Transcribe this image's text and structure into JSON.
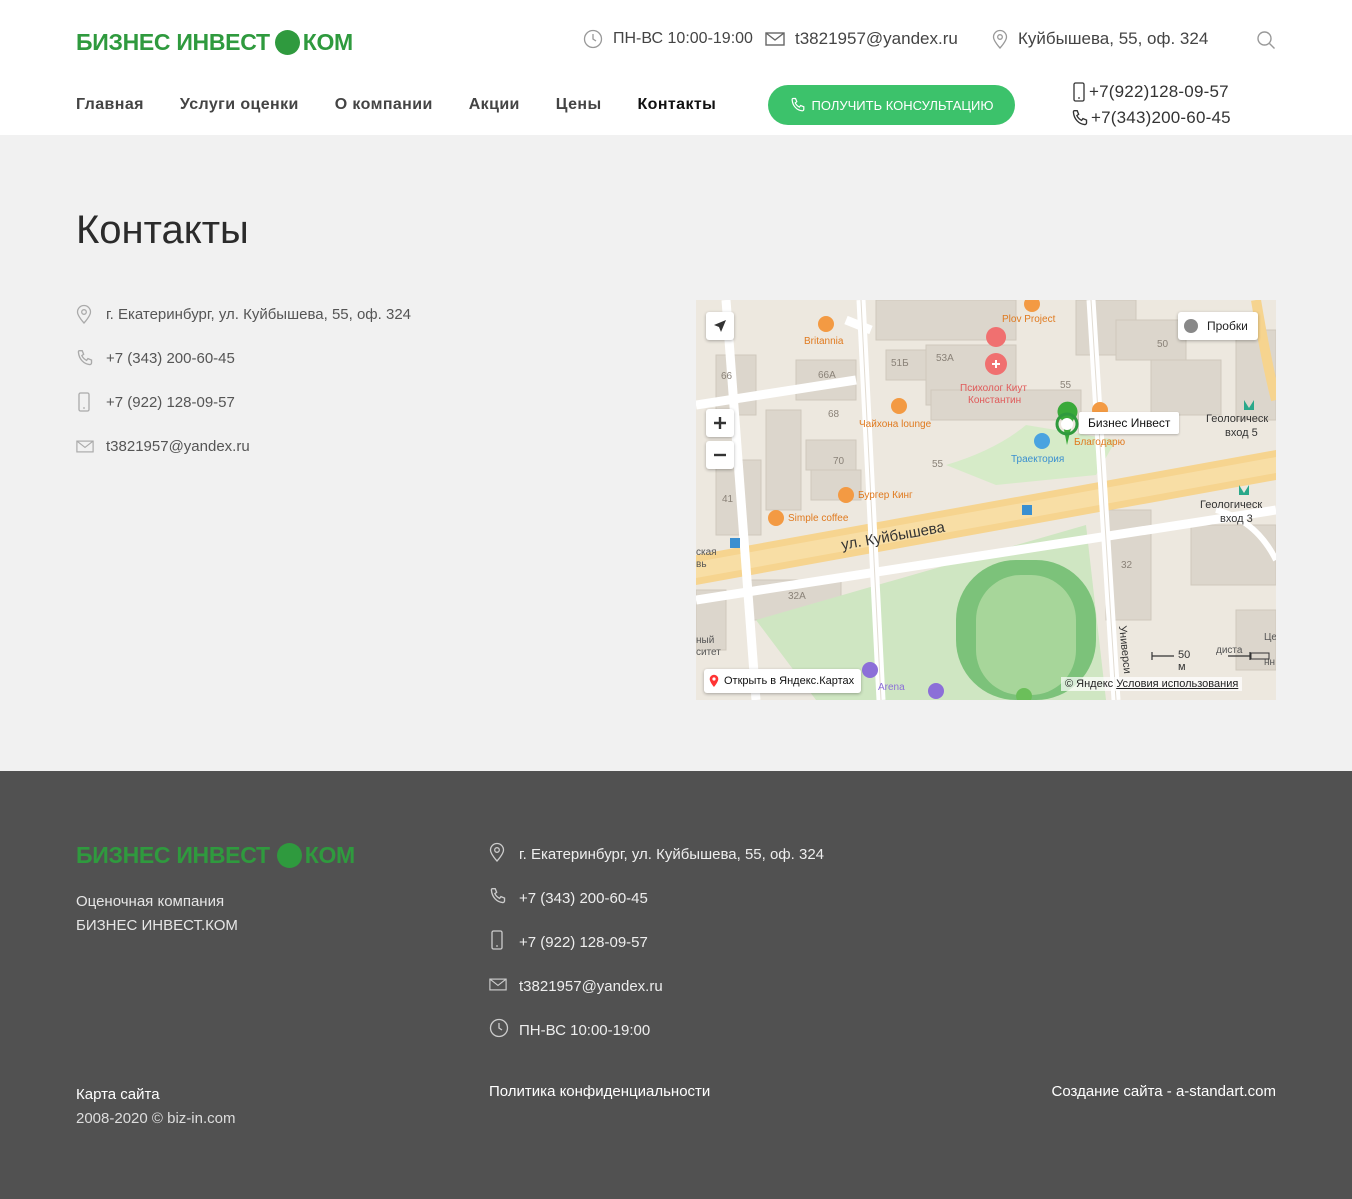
{
  "header": {
    "logo": {
      "left": "БИЗНЕС ИНВЕСТ",
      "right": "КОМ"
    },
    "hours": "ПН-ВС 10:00-19:00",
    "email": "t3821957@yandex.ru",
    "address": "Куйбышева, 55, оф. 324",
    "nav": [
      "Главная",
      "Услуги оценки",
      "О компании",
      "Акции",
      "Цены",
      "Контакты"
    ],
    "consult_label": "ПОЛУЧИТЬ КОНСУЛЬТАЦИЮ",
    "phone_mobile": "+7(922)128-09-57",
    "phone_office": "+7(343)200-60-45"
  },
  "main": {
    "title": "Контакты",
    "address": "г. Екатеринбург, ул. Куйбышева, 55, оф. 324",
    "phone_office": "+7 (343) 200-60-45",
    "phone_mobile": "+7 (922) 128-09-57",
    "email": "t3821957@yandex.ru"
  },
  "map": {
    "traffic_label": "Пробки",
    "pin_label": "Бизнес Инвест",
    "open_label": "Открыть в Яндекс.Картах",
    "copyright": "© Яндекс",
    "terms": "Условия использования",
    "scale": "50 м",
    "labels": {
      "plov": "Plov Project",
      "britannia": "Britannia",
      "n66": "66",
      "n66a": "66А",
      "n51b": "51Б",
      "n53a": "53А",
      "psych": "Психолог Киут",
      "psych2": "Константин",
      "n50": "50",
      "n55a": "55",
      "n68": "68",
      "chaihona": "Чайхона lounge",
      "blagodaryu": "Благодарю",
      "trajectory": "Траектория",
      "geo5": "Геологическ",
      "geo5b": "вход 5",
      "n70": "70",
      "n55": "55",
      "burger": "Бургер Кинг",
      "n41": "41",
      "simple": "Simple coffee",
      "geo3": "Геологическ",
      "geo3b": "вход 3",
      "street": "ул. Куйбышева",
      "street2": "Универси",
      "skaya": "ская",
      "skaya2": "вь",
      "n32": "32",
      "n32a": "32А",
      "ny": "ный",
      "sitet": "ситет",
      "arena": "Arena",
      "ce": "Це",
      "dista": "диста",
      "nn": "нн"
    }
  },
  "footer": {
    "logo": {
      "left": "БИЗНЕС ИНВЕСТ",
      "right": "КОМ"
    },
    "desc1": "Оценочная компания",
    "desc2": "БИЗНЕС ИНВЕСТ.КОМ",
    "address": "г. Екатеринбург, ул. Куйбышева, 55, оф. 324",
    "phone_office": "+7 (343) 200-60-45",
    "phone_mobile": "+7 (922) 128-09-57",
    "email": "t3821957@yandex.ru",
    "hours": "ПН-ВС 10:00-19:00",
    "sitemap": "Карта сайта",
    "copyright": "2008-2020 © biz-in.com",
    "privacy": "Политика конфиденциальности",
    "creator": "Создание сайта - a-standart.com"
  }
}
